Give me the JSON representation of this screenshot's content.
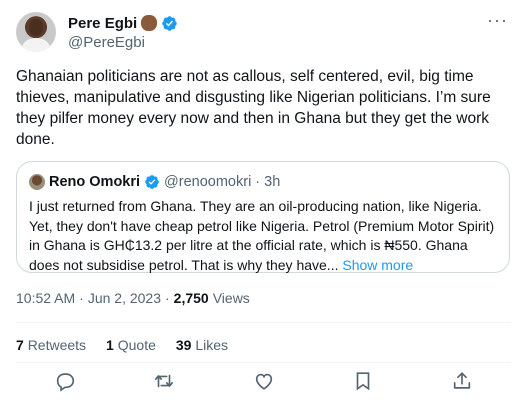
{
  "author": {
    "display_name": "Pere Egbi",
    "handle": "@PereEgbi"
  },
  "tweet": {
    "text": "Ghanaian politicians are not as callous, self centered, evil, big time thieves, manipulative and disgusting like Nigerian politicians. I’m sure they pilfer money every now and then in Ghana but they get the work done."
  },
  "quoted": {
    "display_name": "Reno Omokri",
    "handle": "@renoomokri",
    "separator": "·",
    "time": "3h",
    "text": "I just returned from Ghana. They are an oil-producing nation, like Nigeria. Yet, they don't have cheap petrol like Nigeria. Petrol (Premium Motor Spirit) in Ghana is GH₵13.2 per litre at the official rate, which is ₦550. Ghana does not subsidise petrol. That is why they have... ",
    "show_more": "Show more"
  },
  "meta": {
    "time": "10:52 AM",
    "separator": "·",
    "date": "Jun 2, 2023",
    "separator2": "·",
    "views_count": "2,750",
    "views_label": "Views"
  },
  "stats": {
    "retweets_count": "7",
    "retweets_label": "Retweets",
    "quotes_count": "1",
    "quotes_label": "Quote",
    "likes_count": "39",
    "likes_label": "Likes"
  },
  "icons": {
    "verified": "verified-badge-icon",
    "more": "more-icon",
    "reply": "reply-icon",
    "retweet": "retweet-icon",
    "like": "heart-icon",
    "bookmark": "bookmark-icon",
    "share": "share-icon"
  },
  "colors": {
    "accent": "#1d9bf0",
    "text": "#0f1419",
    "secondary": "#536471",
    "border": "#cfd9de"
  }
}
